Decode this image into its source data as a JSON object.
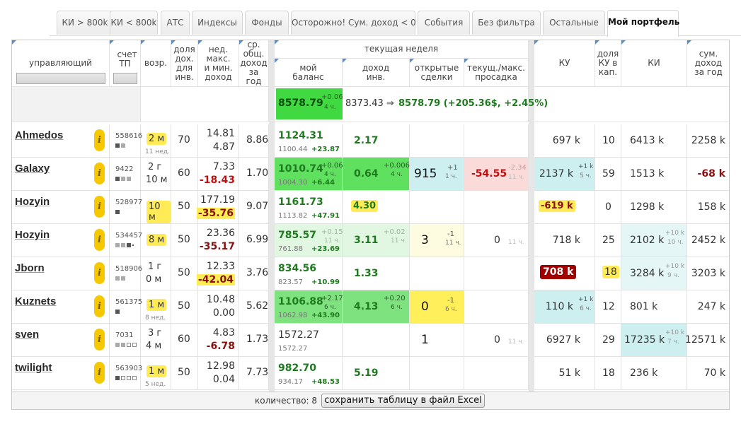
{
  "tabs": [
    {
      "label": "КИ > 800k",
      "active": false
    },
    {
      "label": "КИ < 800k",
      "active": false
    },
    {
      "label": "АТС",
      "active": false
    },
    {
      "label": "Индексы",
      "active": false
    },
    {
      "label": "Фонды",
      "active": false
    },
    {
      "label": "Осторожно! Сум. доход < 0",
      "active": false
    },
    {
      "label": "События",
      "active": false
    },
    {
      "label": "Без фильтра",
      "active": false
    },
    {
      "label": "Остальные",
      "active": false
    },
    {
      "label": "Мой портфель",
      "active": true
    }
  ],
  "headers": {
    "manager": "управляющий",
    "account": "счет ТП",
    "age": "возр.",
    "share": "доля дох. для инв.",
    "week_maxmin": "нед. макс. и мин. доход",
    "avg": "ср. общ. доход за год",
    "current_week": "текущая неделя",
    "my_balance": "мой баланс",
    "income": "доход инв.",
    "open_deals": "открытые сделки",
    "drawdown": "текущ./макс. просадка",
    "ku": "КУ",
    "ku_share": "доля КУ в кап.",
    "ki": "КИ",
    "sum_income": "сум. доход за год"
  },
  "summary": {
    "balance": "8578.79",
    "balance_delta": "+0.06",
    "balance_hours": "4 ч.",
    "transition_from": "8373.43 ⇒",
    "transition_to": "8578.79 (+205.36$, +2.45%)"
  },
  "rows": [
    {
      "name": "Ahmedos",
      "account": "558616",
      "squares": [
        "f",
        "m"
      ],
      "age": "2 м",
      "age_sub": "11 нед.",
      "age_hl": true,
      "share": "70",
      "wmax": "14.81",
      "wmin": "4.87",
      "wmin_class": "",
      "wmin_hl": false,
      "avg": "8.86",
      "bal": "1124.31",
      "bal_sub": "1100.44",
      "bal_sub2": "+23.87",
      "bal_bg": "",
      "bal_d": "",
      "bal_h": "",
      "inc": "2.17",
      "inc_bg": "",
      "inc_d": "",
      "inc_h": "",
      "open": "",
      "open_bg": "",
      "open_d": "",
      "open_h": "",
      "dd": "",
      "dd_bg": "",
      "dd_d": "",
      "dd_h": "",
      "ku": "697 k",
      "ku_bg": "",
      "ku_d": "",
      "ku_h": "",
      "kus": "10",
      "kus_hl": false,
      "ki": "6413 k",
      "ki_bg": "",
      "ki_d": "",
      "ki_h": "",
      "sum": "2258 k",
      "sum_class": ""
    },
    {
      "name": "Galaxy",
      "account": "9422",
      "squares": [
        "f",
        "m",
        "m"
      ],
      "age": "2 г",
      "age2": "10 м",
      "age_sub": "",
      "age_hl": false,
      "share": "60",
      "wmax": "7.33",
      "wmin": "-18.43",
      "wmin_class": "red",
      "wmin_hl": false,
      "avg": "1.70",
      "bal": "1010.74",
      "bal_sub": "1004.30",
      "bal_sub2": "+6.44",
      "bal_bg": "#5fe05f",
      "bal_d": "+0.06",
      "bal_h": "4 ч.",
      "inc": "0.64",
      "inc_bg": "#5fe05f",
      "inc_d": "+0.006",
      "inc_h": "4 ч.",
      "open": "915",
      "open_bg": "#cdeff0",
      "open_d": "+1",
      "open_h": "1 ч.",
      "dd": "-54.55",
      "dd_bg": "#fbdada",
      "dd_d": "-2.34",
      "dd_h": "11 ч.",
      "ku": "2137 k",
      "ku_bg": "#cdeff0",
      "ku_d": "+1 k",
      "ku_h": "5 ч.",
      "kus": "59",
      "kus_hl": false,
      "ki": "1513 k",
      "ki_bg": "",
      "ki_d": "",
      "ki_h": "",
      "sum": "-68 k",
      "sum_class": "darkred"
    },
    {
      "name": "Hozyin",
      "account": "528977",
      "squares": [
        "f"
      ],
      "age": "10 м",
      "age_sub": "",
      "age_hl": true,
      "share": "50",
      "wmax": "177.19",
      "wmin": "-35.76",
      "wmin_class": "darkred",
      "wmin_hl": true,
      "avg": "9.07",
      "bal": "1161.73",
      "bal_sub": "1113.82",
      "bal_sub2": "+47.91",
      "bal_bg": "",
      "bal_d": "",
      "bal_h": "",
      "inc": "4.30",
      "inc_bg": "pill",
      "inc_d": "",
      "inc_h": "",
      "open": "",
      "open_bg": "",
      "open_d": "",
      "open_h": "",
      "dd": "",
      "dd_bg": "",
      "dd_d": "",
      "dd_h": "",
      "ku": "-619 k",
      "ku_bg": "pillred",
      "ku_d": "",
      "ku_h": "",
      "kus": "0",
      "kus_hl": false,
      "ki": "1298 k",
      "ki_bg": "",
      "ki_d": "",
      "ki_h": "",
      "sum": "158 k",
      "sum_class": ""
    },
    {
      "name": "Hozyin",
      "account": "534457",
      "squares": [
        "m",
        "m",
        "f",
        "d"
      ],
      "age": "8 м",
      "age_sub": "",
      "age_hl": true,
      "share": "50",
      "wmax": "23.36",
      "wmin": "-35.17",
      "wmin_class": "darkred",
      "wmin_hl": false,
      "avg": "6.99",
      "bal": "785.57",
      "bal_sub": "761.88",
      "bal_sub2": "+23.69",
      "bal_bg": "#e2f7e2",
      "bal_d": "+0.15",
      "bal_h": "11 ч.",
      "inc": "3.11",
      "inc_bg": "#e2f7e2",
      "inc_d": "+0.02",
      "inc_h": "11 ч.",
      "open": "3",
      "open_bg": "#fdfbe0",
      "open_d": "-1",
      "open_h": "11 ч.",
      "dd": "0",
      "dd_bg": "",
      "dd_d": "",
      "dd_h": "11 ч.",
      "ku": "718 k",
      "ku_bg": "",
      "ku_d": "",
      "ku_h": "",
      "kus": "25",
      "kus_hl": false,
      "ki": "2102 k",
      "ki_bg": "#e4f6f6",
      "ki_d": "+10 k",
      "ki_h": "10 ч.",
      "sum": "2452 k",
      "sum_class": ""
    },
    {
      "name": "Jborn",
      "account": "518906",
      "squares": [
        "m",
        "m"
      ],
      "age": "1 г",
      "age2": "0 м",
      "age_sub": "",
      "age_hl": false,
      "share": "50",
      "wmax": "12.33",
      "wmin": "-42.04",
      "wmin_class": "darkred",
      "wmin_hl": true,
      "avg": "3.76",
      "bal": "834.56",
      "bal_sub": "823.57",
      "bal_sub2": "+10.99",
      "bal_bg": "",
      "bal_d": "",
      "bal_h": "",
      "inc": "1.33",
      "inc_bg": "",
      "inc_d": "",
      "inc_h": "",
      "open": "",
      "open_bg": "",
      "open_d": "",
      "open_h": "",
      "dd": "",
      "dd_bg": "",
      "dd_d": "",
      "dd_h": "",
      "ku": "708 k",
      "ku_bg": "darkpill",
      "ku_d": "",
      "ku_h": "",
      "kus": "18",
      "kus_hl": true,
      "ki": "3284 k",
      "ki_bg": "#e4f6f6",
      "ki_d": "+10 k",
      "ki_h": "9 ч.",
      "sum": "3203 k",
      "sum_class": ""
    },
    {
      "name": "Kuznets",
      "account": "561375",
      "squares": [
        "f"
      ],
      "age": "1 м",
      "age_sub": "8 нед.",
      "age_hl": true,
      "share": "50",
      "wmax": "10.48",
      "wmin": "0.00",
      "wmin_class": "",
      "wmin_hl": false,
      "avg": "5.62",
      "bal": "1106.88",
      "bal_sub": "1062.98",
      "bal_sub2": "+43.90",
      "bal_bg": "#7ee37e",
      "bal_d": "+2.17",
      "bal_h": "6 ч.",
      "inc": "4.13",
      "inc_bg": "#7ee37e",
      "inc_d": "+0.20",
      "inc_h": "6 ч.",
      "open": "0",
      "open_bg": "#ffef5a",
      "open_d": "-1",
      "open_h": "6 ч.",
      "dd": "",
      "dd_bg": "",
      "dd_d": "",
      "dd_h": "",
      "ku": "110 k",
      "ku_bg": "#cdeff0",
      "ku_d": "+1 k",
      "ku_h": "6 ч.",
      "kus": "12",
      "kus_hl": false,
      "ki": "801 k",
      "ki_bg": "",
      "ki_d": "",
      "ki_h": "",
      "sum": "247 k",
      "sum_class": ""
    },
    {
      "name": "sven",
      "account": "7031",
      "squares": [
        "m",
        "m",
        "e",
        "e"
      ],
      "age": "3 г",
      "age2": "4 м",
      "age_sub": "",
      "age_hl": false,
      "share": "60",
      "wmax": "4.83",
      "wmin": "-6.78",
      "wmin_class": "darkred",
      "wmin_hl": false,
      "avg": "1.73",
      "bal": "1572.27",
      "bal_sub": "1572.27",
      "bal_sub2": "",
      "bal_bg": "",
      "bal_d": "",
      "bal_h": "",
      "bal_plain": true,
      "inc": "",
      "inc_bg": "",
      "inc_d": "",
      "inc_h": "",
      "open": "1",
      "open_bg": "",
      "open_d": "",
      "open_h": "",
      "dd": "0",
      "dd_bg": "",
      "dd_d": "",
      "dd_h": "11 ч.",
      "ku": "6927 k",
      "ku_bg": "",
      "ku_d": "",
      "ku_h": "",
      "kus": "29",
      "kus_hl": false,
      "ki": "17235 k",
      "ki_bg": "#cdeff0",
      "ki_d": "+10 k",
      "ki_h": "7 ч.",
      "sum": "12571 k",
      "sum_class": ""
    },
    {
      "name": "twilight",
      "account": "563903",
      "squares": [
        "f",
        "e",
        "e",
        "e"
      ],
      "age": "1 м",
      "age_sub": "5 нед.",
      "age_hl": true,
      "share": "50",
      "wmax": "12.98",
      "wmin": "0.04",
      "wmin_class": "",
      "wmin_hl": false,
      "avg": "7.73",
      "bal": "982.70",
      "bal_sub": "934.17",
      "bal_sub2": "+48.53",
      "bal_bg": "",
      "bal_d": "",
      "bal_h": "",
      "inc": "5.19",
      "inc_bg": "",
      "inc_d": "",
      "inc_h": "",
      "open": "",
      "open_bg": "",
      "open_d": "",
      "open_h": "",
      "dd": "",
      "dd_bg": "",
      "dd_d": "",
      "dd_h": "",
      "ku": "51 k",
      "ku_bg": "",
      "ku_d": "",
      "ku_h": "",
      "kus": "18",
      "kus_hl": false,
      "ki": "236 k",
      "ki_bg": "",
      "ki_d": "",
      "ki_h": "",
      "sum": "70 k",
      "sum_class": ""
    }
  ],
  "footer": {
    "count": "количество: 8",
    "export_label": "сохранить таблицу в файл Excel"
  },
  "icon_names": {
    "info": "info-icon"
  },
  "colors": {
    "highlight_yellow": "#ffeb55",
    "positive_green": "#1f7a1f",
    "negative_red": "#c01010"
  }
}
